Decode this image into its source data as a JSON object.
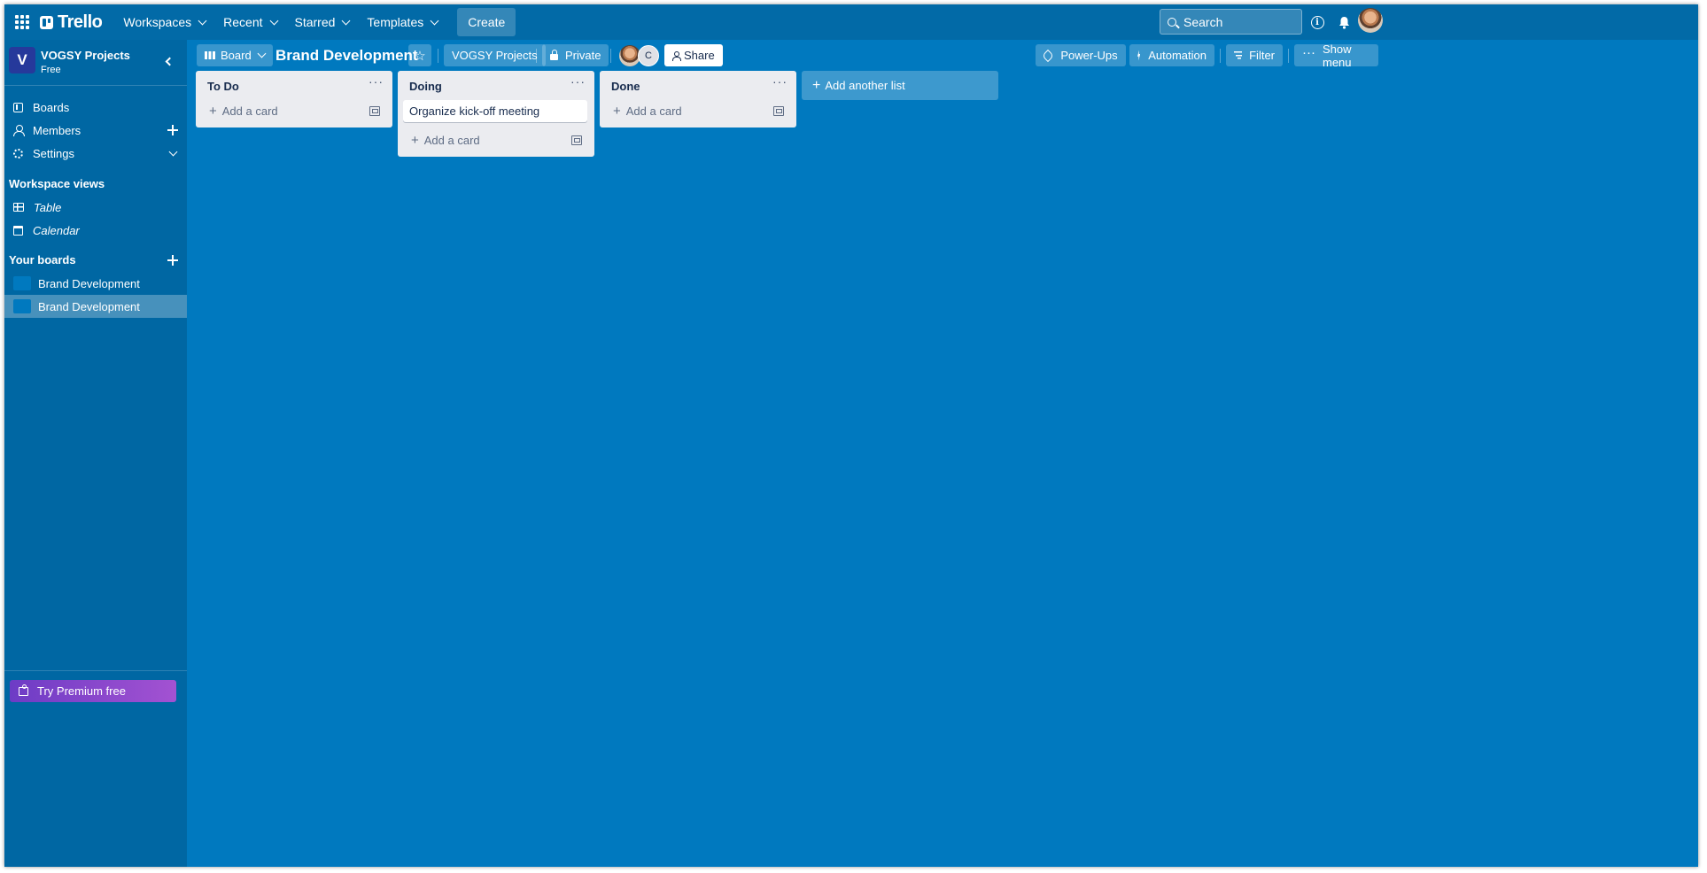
{
  "nav": {
    "logo": "Trello",
    "items": [
      "Workspaces",
      "Recent",
      "Starred",
      "Templates"
    ],
    "create": "Create",
    "search_placeholder": "Search",
    "info_glyph": "i"
  },
  "workspace": {
    "badge": "V",
    "name": "VOGSY Projects",
    "plan": "Free"
  },
  "sidebar": {
    "items": [
      {
        "label": "Boards",
        "icon": "board-icon"
      },
      {
        "label": "Members",
        "icon": "member-icon"
      },
      {
        "label": "Settings",
        "icon": "gear-icon"
      }
    ],
    "workspace_views_heading": "Workspace views",
    "views": [
      {
        "label": "Table",
        "icon": "table-icon"
      },
      {
        "label": "Calendar",
        "icon": "calendar-icon"
      }
    ],
    "your_boards_heading": "Your boards",
    "boards": [
      {
        "label": "Brand Development",
        "active": false
      },
      {
        "label": "Brand Development",
        "active": true
      }
    ],
    "premium": "Try Premium free"
  },
  "board": {
    "view_label": "Board",
    "title": "Brand Development",
    "workspace_label": "VOGSY Projects",
    "visibility": "Private",
    "member_initial": "C",
    "share": "Share",
    "powerups": "Power-Ups",
    "automation": "Automation",
    "filter": "Filter",
    "show_menu": "Show menu",
    "menu_glyph": "···"
  },
  "lists": [
    {
      "title": "To Do",
      "cards": [],
      "add_card": "Add a card"
    },
    {
      "title": "Doing",
      "cards": [
        "Organize kick-off meeting"
      ],
      "add_card": "Add a card"
    },
    {
      "title": "Done",
      "cards": [],
      "add_card": "Add a card"
    }
  ],
  "add_list": "Add another list",
  "colors": {
    "board_bg": "#0079bf",
    "nav_bg": "#026aa7",
    "sidebar_bg": "#0067a3",
    "list_bg": "#ebecf0",
    "premium_gradient_start": "#6d3cc5",
    "premium_gradient_end": "#a352d2"
  }
}
